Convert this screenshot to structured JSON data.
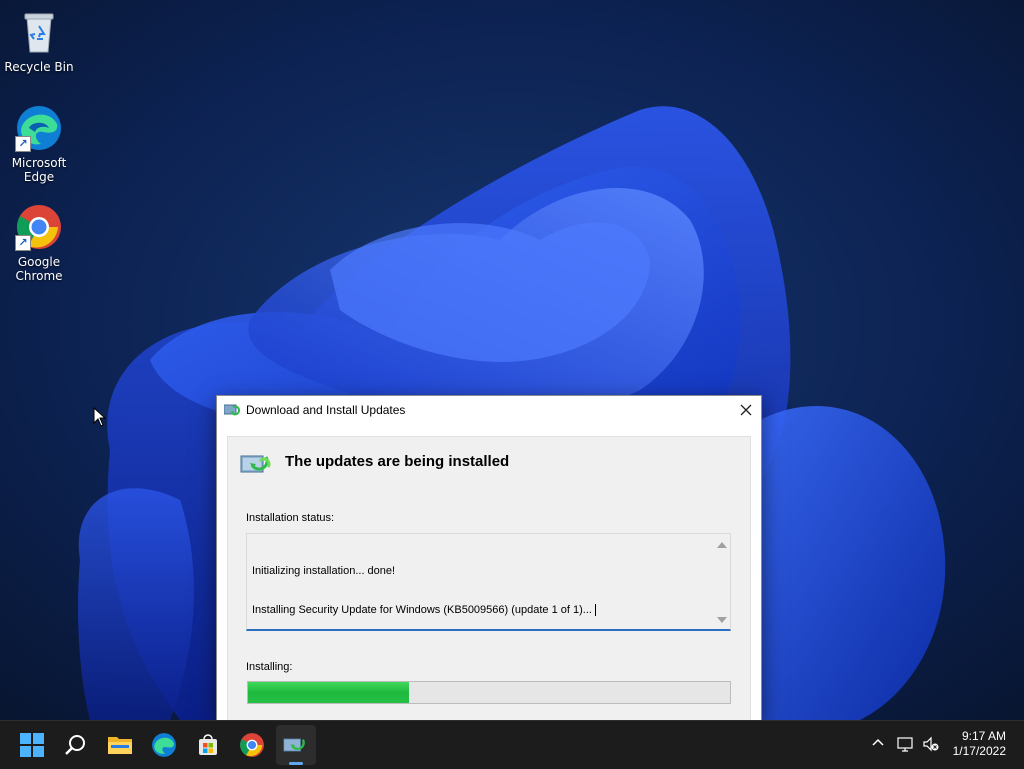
{
  "desktop": {
    "icons": [
      {
        "label_line1": "Recycle Bin",
        "label_line2": ""
      },
      {
        "label_line1": "Microsoft",
        "label_line2": "Edge"
      },
      {
        "label_line1": "Google",
        "label_line2": "Chrome"
      }
    ]
  },
  "dialog": {
    "title": "Download and Install Updates",
    "heading": "The updates are being installed",
    "status_label": "Installation status:",
    "status_lines": [
      "Initializing installation... done!",
      "Installing Security Update for Windows (KB5009566) (update 1 of 1)..."
    ],
    "progress_label": "Installing:",
    "progress_fraction": 0.335,
    "close_icon": "close-icon"
  },
  "taskbar": {
    "items": [
      "windows-start-icon",
      "search-icon",
      "file-explorer-icon",
      "edge-icon",
      "store-icon",
      "chrome-icon",
      "windows-update-icon"
    ],
    "clock_time": "9:17 AM",
    "clock_date": "1/17/2022"
  },
  "colors": {
    "progress_green": "#26c046",
    "accent_blue": "#2b6fbf",
    "taskbar_bg": "#1c1c1c"
  }
}
